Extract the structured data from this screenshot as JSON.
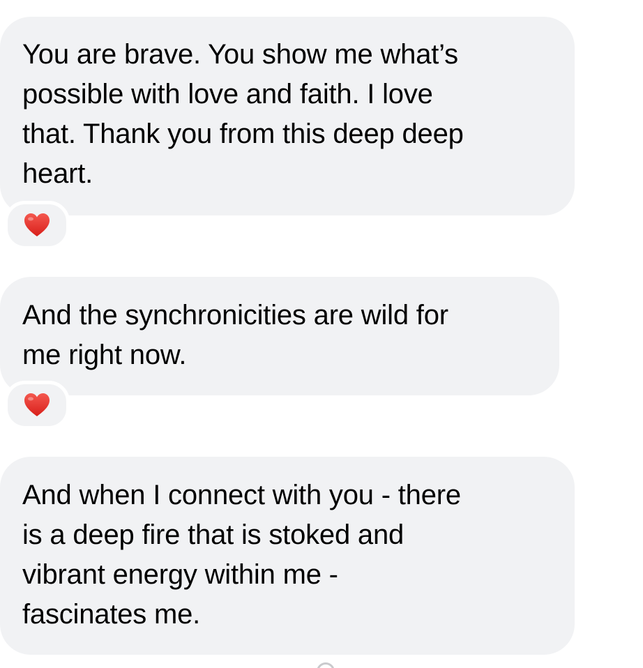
{
  "messages": [
    {
      "text": "You are brave. You show me what’s\npossible with love and faith. I love\nthat. Thank you from this deep deep\nheart.",
      "reaction": "heart"
    },
    {
      "text": "And the synchronicities are wild for\nme right now.",
      "reaction": "heart"
    },
    {
      "text": "And when I connect with you - there\nis a deep fire that is stoked and\nvibrant energy within me -\nfascinates me.",
      "reaction": null
    }
  ],
  "colors": {
    "bubble_background": "#f1f2f4",
    "text": "#000000",
    "heart": "#e8302a"
  },
  "icons": {
    "reaction_icon": "red-heart-icon"
  }
}
